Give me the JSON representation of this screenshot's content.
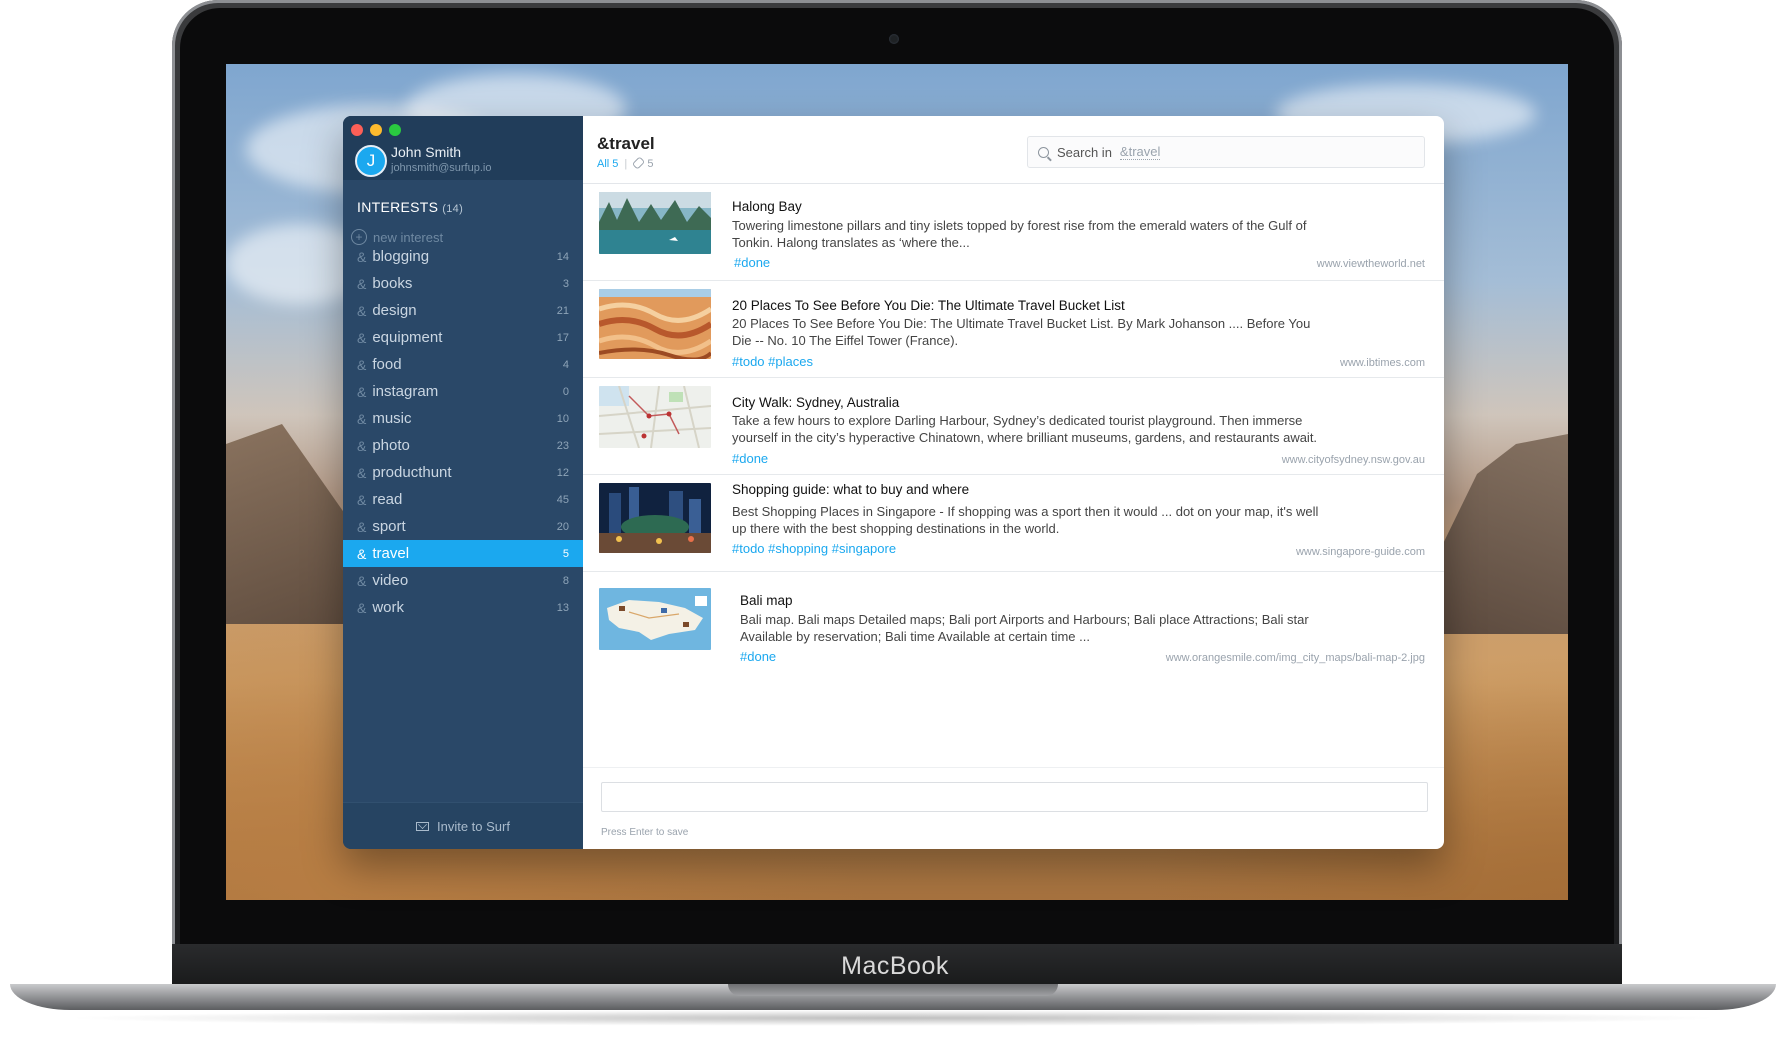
{
  "device": {
    "brand": "MacBook"
  },
  "user": {
    "initial": "J",
    "name": "John Smith",
    "email": "johnsmith@surfup.io"
  },
  "sidebar": {
    "interests_label": "INTERESTS",
    "interests_count": "(14)",
    "new_interest_placeholder": "new interest",
    "items": [
      {
        "label": "blogging",
        "count": "14"
      },
      {
        "label": "books",
        "count": "3"
      },
      {
        "label": "design",
        "count": "21"
      },
      {
        "label": "equipment",
        "count": "17"
      },
      {
        "label": "food",
        "count": "4"
      },
      {
        "label": "instagram",
        "count": "0"
      },
      {
        "label": "music",
        "count": "10"
      },
      {
        "label": "photo",
        "count": "23"
      },
      {
        "label": "producthunt",
        "count": "12"
      },
      {
        "label": "read",
        "count": "45"
      },
      {
        "label": "sport",
        "count": "20"
      },
      {
        "label": "travel",
        "count": "5"
      },
      {
        "label": "video",
        "count": "8"
      },
      {
        "label": "work",
        "count": "13"
      }
    ],
    "active_item": "travel",
    "invite_label": "Invite to Surf"
  },
  "main": {
    "title": "&travel",
    "filter_all": "All",
    "filter_all_count": "5",
    "links_count": "5",
    "search": {
      "prefix": "Search in",
      "scope": "&travel"
    },
    "cards": [
      {
        "title": "Halong Bay",
        "description": "Towering limestone pillars and tiny islets topped by forest rise from the emerald waters of the Gulf of Tonkin. Halong translates as ‘where the...",
        "tags": "#done",
        "url": "www.viewtheworld.net"
      },
      {
        "title": "20 Places To See Before You Die: The Ultimate Travel Bucket List",
        "description": "20 Places To See Before You Die: The Ultimate Travel Bucket List. By Mark Johanson .... Before You Die -- No. 10 The Eiffel Tower (France).",
        "tags": "#todo #places",
        "url": "www.ibtimes.com"
      },
      {
        "title": "City Walk: Sydney, Australia",
        "description": "Take a few hours to explore Darling Harbour, Sydney’s dedicated tourist playground. Then immerse yourself in the city’s hyperactive Chinatown, where brilliant museums, gardens, and restaurants await.",
        "tags": "#done",
        "url": "www.cityofsydney.nsw.gov.au"
      },
      {
        "title": "Shopping guide: what to buy and where",
        "description": "Best Shopping Places in Singapore - If shopping was a sport then it would ... dot on your map, it's well up there with the best shopping destinations in the world.",
        "tags": "#todo #shopping #singapore",
        "url": "www.singapore-guide.com"
      },
      {
        "title": "Bali map",
        "description": "Bali map. Bali maps Detailed maps; Bali port Airports and Harbours; Bali place Attractions; Bali star Available by reservation; Bali time Available at certain time ...",
        "tags": "#done",
        "url": "www.orangesmile.com/img_city_maps/bali-map-2.jpg"
      }
    ],
    "save_hint": "Press Enter to save"
  },
  "colors": {
    "accent": "#1ba8ef",
    "sidebar_bg": "#2a4868",
    "sidebar_header": "#213d5a"
  }
}
